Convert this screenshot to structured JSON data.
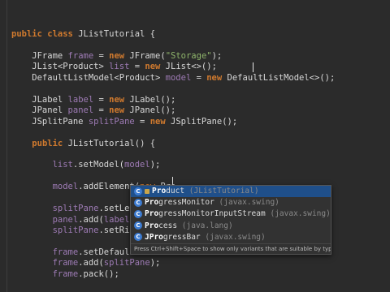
{
  "editor": {
    "lines": [
      {
        "segments": [
          {
            "t": "public class ",
            "c": "kw"
          },
          {
            "t": "JListTutorial {",
            "c": "plain"
          }
        ]
      },
      {
        "segments": [
          {
            "t": "",
            "c": "plain"
          }
        ]
      },
      {
        "segments": [
          {
            "t": "    JFrame ",
            "c": "plain"
          },
          {
            "t": "frame",
            "c": "id"
          },
          {
            "t": " = ",
            "c": "plain"
          },
          {
            "t": "new ",
            "c": "kw"
          },
          {
            "t": "JFrame(",
            "c": "plain"
          },
          {
            "t": "\"Storage\"",
            "c": "str"
          },
          {
            "t": ");",
            "c": "plain"
          }
        ]
      },
      {
        "segments": [
          {
            "t": "    JList<Product> ",
            "c": "plain"
          },
          {
            "t": "list",
            "c": "id"
          },
          {
            "t": " = ",
            "c": "plain"
          },
          {
            "t": "new ",
            "c": "kw"
          },
          {
            "t": "JList<>();",
            "c": "plain"
          }
        ]
      },
      {
        "segments": [
          {
            "t": "    DefaultListModel<Product> ",
            "c": "plain"
          },
          {
            "t": "model",
            "c": "id"
          },
          {
            "t": " = ",
            "c": "plain"
          },
          {
            "t": "new ",
            "c": "kw"
          },
          {
            "t": "DefaultListModel<>();",
            "c": "plain"
          }
        ]
      },
      {
        "segments": [
          {
            "t": "",
            "c": "plain"
          }
        ]
      },
      {
        "segments": [
          {
            "t": "    JLabel ",
            "c": "plain"
          },
          {
            "t": "label",
            "c": "id"
          },
          {
            "t": " = ",
            "c": "plain"
          },
          {
            "t": "new ",
            "c": "kw"
          },
          {
            "t": "JLabel();",
            "c": "plain"
          }
        ]
      },
      {
        "segments": [
          {
            "t": "    JPanel ",
            "c": "plain"
          },
          {
            "t": "panel",
            "c": "id"
          },
          {
            "t": " = ",
            "c": "plain"
          },
          {
            "t": "new ",
            "c": "kw"
          },
          {
            "t": "JPanel();",
            "c": "plain"
          }
        ]
      },
      {
        "segments": [
          {
            "t": "    JSplitPane ",
            "c": "plain"
          },
          {
            "t": "splitPane",
            "c": "id"
          },
          {
            "t": " = ",
            "c": "plain"
          },
          {
            "t": "new ",
            "c": "kw"
          },
          {
            "t": "JSplitPane();",
            "c": "plain"
          }
        ]
      },
      {
        "segments": [
          {
            "t": "",
            "c": "plain"
          }
        ]
      },
      {
        "segments": [
          {
            "t": "    ",
            "c": "plain"
          },
          {
            "t": "public ",
            "c": "kw"
          },
          {
            "t": "JListTutorial() {",
            "c": "plain"
          }
        ]
      },
      {
        "segments": [
          {
            "t": "",
            "c": "plain"
          }
        ]
      },
      {
        "segments": [
          {
            "t": "        ",
            "c": "plain"
          },
          {
            "t": "list",
            "c": "id"
          },
          {
            "t": ".setModel(",
            "c": "plain"
          },
          {
            "t": "model",
            "c": "id"
          },
          {
            "t": ");",
            "c": "plain"
          }
        ]
      },
      {
        "segments": [
          {
            "t": "",
            "c": "plain"
          }
        ]
      },
      {
        "segments": [
          {
            "t": "        ",
            "c": "plain"
          },
          {
            "t": "model",
            "c": "id"
          },
          {
            "t": ".addElement(",
            "c": "plain"
          },
          {
            "t": "new ",
            "c": "kw"
          },
          {
            "t": "Pro",
            "c": "plain"
          }
        ]
      },
      {
        "segments": [
          {
            "t": "",
            "c": "plain"
          }
        ]
      },
      {
        "segments": [
          {
            "t": "        ",
            "c": "plain"
          },
          {
            "t": "splitPane",
            "c": "id"
          },
          {
            "t": ".setLeft",
            "c": "plain"
          }
        ]
      },
      {
        "segments": [
          {
            "t": "        ",
            "c": "plain"
          },
          {
            "t": "panel",
            "c": "id"
          },
          {
            "t": ".add(",
            "c": "plain"
          },
          {
            "t": "label",
            "c": "id"
          },
          {
            "t": ");",
            "c": "plain"
          }
        ]
      },
      {
        "segments": [
          {
            "t": "        ",
            "c": "plain"
          },
          {
            "t": "splitPane",
            "c": "id"
          },
          {
            "t": ".setRigh",
            "c": "plain"
          }
        ]
      },
      {
        "segments": [
          {
            "t": "",
            "c": "plain"
          }
        ]
      },
      {
        "segments": [
          {
            "t": "        ",
            "c": "plain"
          },
          {
            "t": "frame",
            "c": "id"
          },
          {
            "t": ".setDefaultC",
            "c": "plain"
          }
        ]
      },
      {
        "segments": [
          {
            "t": "        ",
            "c": "plain"
          },
          {
            "t": "frame",
            "c": "id"
          },
          {
            "t": ".add(",
            "c": "plain"
          },
          {
            "t": "splitPane",
            "c": "id"
          },
          {
            "t": ");",
            "c": "plain"
          }
        ]
      },
      {
        "segments": [
          {
            "t": "        ",
            "c": "plain"
          },
          {
            "t": "frame",
            "c": "id"
          },
          {
            "t": ".pack();",
            "c": "plain"
          }
        ]
      }
    ]
  },
  "completion": {
    "items": [
      {
        "match": "Pro",
        "rest": "duct",
        "pkg": "(JListTutorial)",
        "icon": "class-icon",
        "icon_letter": "C",
        "private": true,
        "selected": true
      },
      {
        "match": "Pro",
        "rest": "gressMonitor",
        "pkg": "(javax.swing)",
        "icon": "class-icon",
        "icon_letter": "C",
        "private": false,
        "selected": false
      },
      {
        "match": "Pro",
        "rest": "gressMonitorInputStream",
        "pkg": "(javax.swing)",
        "icon": "class-icon",
        "icon_letter": "C",
        "private": false,
        "selected": false
      },
      {
        "match": "Pro",
        "rest": "cess",
        "pkg": "(java.lang)",
        "icon": "class-icon",
        "icon_letter": "C",
        "private": false,
        "selected": false
      },
      {
        "match": "JPro",
        "rest": "gressBar",
        "pkg": "(javax.swing)",
        "icon": "class-icon",
        "icon_letter": "C",
        "private": false,
        "selected": false
      }
    ],
    "footer_text": "Press Ctrl+Shift+Space to show only variants that are suitable by type",
    "footer_link": ">>"
  },
  "colors": {
    "background": "#2b2b2b",
    "keyword": "#d07a2e",
    "identifier": "#9e7bb5",
    "string": "#8fb56b",
    "selection": "#1f4f8a"
  }
}
